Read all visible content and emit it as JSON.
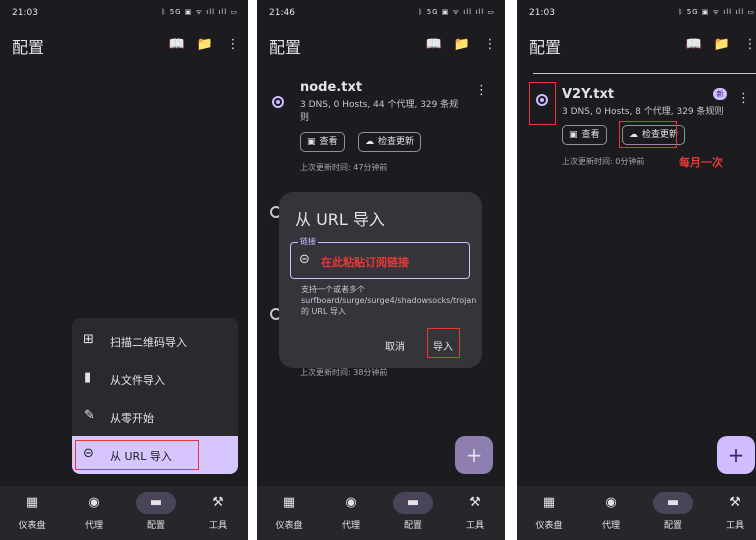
{
  "screens": [
    {
      "time": "21:03",
      "status_icons": "ᛒ 5G ▣ ᯤ ıll ıll ▭",
      "title": "配置",
      "menu": {
        "items": [
          {
            "icon": "qr-scan-icon",
            "label": "扫描二维码导入"
          },
          {
            "icon": "file-icon",
            "label": "从文件导入"
          },
          {
            "icon": "pencil-icon",
            "label": "从零开始"
          },
          {
            "icon": "link-icon",
            "label": "从 URL 导入"
          }
        ]
      }
    },
    {
      "time": "21:46",
      "status_icons": "ᛒ 5G ▣ ᯤ ıll ıll ▭",
      "title": "配置",
      "profile": {
        "name": "node.txt",
        "stats": "3 DNS, 0 Hosts, 44 个代理, 329 条规则",
        "view_label": "查看",
        "check_label": "检查更新",
        "updated": "上次更新时间: 47分钟前"
      },
      "behind_updated": "上次更新时间: 38分钟前",
      "dialog": {
        "title": "从 URL 导入",
        "field_label": "链接",
        "field_hint": "在此粘贴订阅链接",
        "help": "支持一个或者多个 surfboard/surge/surge4/shadowsocks/trojan 的 URL 导入",
        "cancel": "取消",
        "confirm": "导入"
      }
    },
    {
      "time": "21:03",
      "status_icons": "ᛒ 5G ▣ ᯤ ıll ıll ▭",
      "title": "配置",
      "profile": {
        "name": "V2Y.txt",
        "badge": "新",
        "stats": "3 DNS, 0 Hosts, 8 个代理, 329 条规则",
        "view_label": "查看",
        "check_label": "检查更新",
        "updated": "上次更新时间: 0分钟前"
      },
      "annotation": "每月一次"
    }
  ],
  "nav": [
    {
      "icon": "dashboard-icon",
      "label": "仪表盘"
    },
    {
      "icon": "proxy-icon",
      "label": "代理"
    },
    {
      "icon": "folder-icon",
      "label": "配置"
    },
    {
      "icon": "tools-icon",
      "label": "工具"
    }
  ],
  "colors": {
    "background": "#1c1b1f",
    "accent": "#d0bcff",
    "highlight": "#e53935"
  }
}
